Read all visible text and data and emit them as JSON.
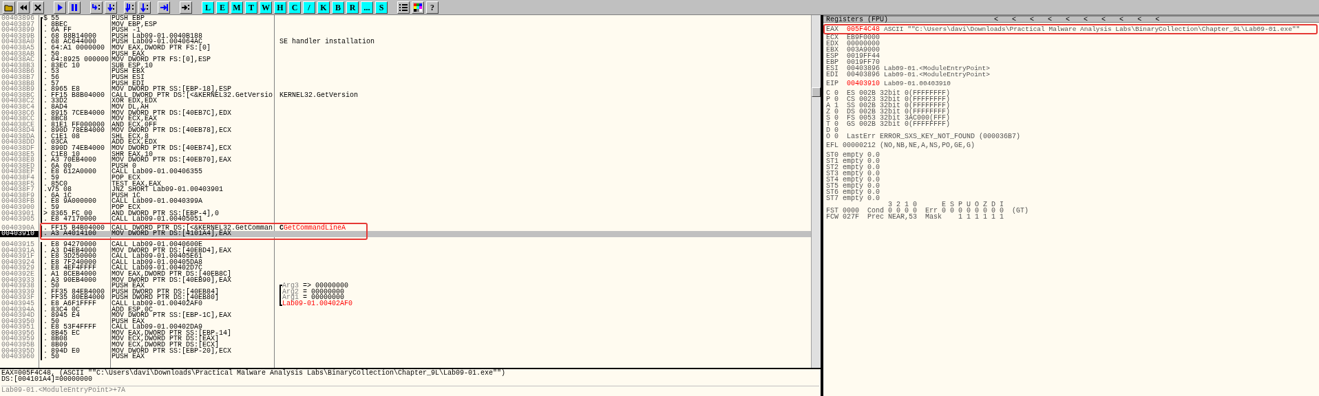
{
  "toolbar": {
    "letter_buttons": [
      "L",
      "E",
      "M",
      "T",
      "W",
      "H",
      "C",
      "/",
      "K",
      "B",
      "R",
      "...",
      "S"
    ],
    "help": "?"
  },
  "disasm": {
    "rows": [
      {
        "address": "00403896",
        "marker": "$",
        "hex": "55",
        "instruction": "PUSH EBP",
        "selected": false
      },
      {
        "address": "00403897",
        "marker": ".",
        "hex": "8BEC",
        "instruction": "MOV EBP,ESP",
        "selected": false
      },
      {
        "address": "00403899",
        "marker": ".",
        "hex": "6A FF",
        "instruction": "PUSH -1",
        "selected": false
      },
      {
        "address": "0040389B",
        "marker": ".",
        "hex": "68 88B14000",
        "instruction": "PUSH Lab09-01.0040B188",
        "selected": false
      },
      {
        "address": "004038A0",
        "marker": ".",
        "hex": "68 AC644000",
        "instruction": "PUSH Lab09-01.004064AC",
        "selected": false,
        "comment": {
          "text": "SE handler installation"
        }
      },
      {
        "address": "004038A5",
        "marker": ".",
        "hex": "64:A1 0000000",
        "instruction": "MOV EAX,DWORD PTR FS:[0]",
        "selected": false
      },
      {
        "address": "004038AB",
        "marker": ".",
        "hex": "50",
        "instruction": "PUSH EAX",
        "selected": false
      },
      {
        "address": "004038AC",
        "marker": ".",
        "hex": "64:8925 000000",
        "instruction": "MOV DWORD PTR FS:[0],ESP",
        "selected": false
      },
      {
        "address": "004038B3",
        "marker": ".",
        "hex": "83EC 10",
        "instruction": "SUB ESP,10",
        "selected": false
      },
      {
        "address": "004038B6",
        "marker": ".",
        "hex": "53",
        "instruction": "PUSH EBX",
        "selected": false
      },
      {
        "address": "004038B7",
        "marker": ".",
        "hex": "56",
        "instruction": "PUSH ESI",
        "selected": false
      },
      {
        "address": "004038B8",
        "marker": ".",
        "hex": "57",
        "instruction": "PUSH EDI",
        "selected": false
      },
      {
        "address": "004038B9",
        "marker": ".",
        "hex": "8965 E8",
        "instruction": "MOV DWORD PTR SS:[EBP-18],ESP",
        "selected": false
      },
      {
        "address": "004038BC",
        "marker": ".",
        "hex": "FF15 B8B04000",
        "instruction": "CALL DWORD PTR DS:[<&KERNEL32.GetVersio",
        "selected": false,
        "comment": {
          "text": "KERNEL32.GetVersion"
        }
      },
      {
        "address": "004038C2",
        "marker": ".",
        "hex": "33D2",
        "instruction": "XOR EDX,EDX",
        "selected": false
      },
      {
        "address": "004038C4",
        "marker": ".",
        "hex": "8AD4",
        "instruction": "MOV DL,AH",
        "selected": false
      },
      {
        "address": "004038C6",
        "marker": ".",
        "hex": "8915 7CEB4000",
        "instruction": "MOV DWORD PTR DS:[40EB7C],EDX",
        "selected": false
      },
      {
        "address": "004038CC",
        "marker": ".",
        "hex": "8BC8",
        "instruction": "MOV ECX,EAX",
        "selected": false
      },
      {
        "address": "004038CE",
        "marker": ".",
        "hex": "81E1 FF000000",
        "instruction": "AND ECX,0FF",
        "selected": false
      },
      {
        "address": "004038D4",
        "marker": ".",
        "hex": "890D 78EB4000",
        "instruction": "MOV DWORD PTR DS:[40EB78],ECX",
        "selected": false
      },
      {
        "address": "004038DA",
        "marker": ".",
        "hex": "C1E1 08",
        "instruction": "SHL ECX,8",
        "selected": false
      },
      {
        "address": "004038DD",
        "marker": ".",
        "hex": "03CA",
        "instruction": "ADD ECX,EDX",
        "selected": false
      },
      {
        "address": "004038DF",
        "marker": ".",
        "hex": "890D 74EB4000",
        "instruction": "MOV DWORD PTR DS:[40EB74],ECX",
        "selected": false
      },
      {
        "address": "004038E5",
        "marker": ".",
        "hex": "C1E8 10",
        "instruction": "SHR EAX,10",
        "selected": false
      },
      {
        "address": "004038E8",
        "marker": ".",
        "hex": "A3 70EB4000",
        "instruction": "MOV DWORD PTR DS:[40EB70],EAX",
        "selected": false
      },
      {
        "address": "004038ED",
        "marker": ".",
        "hex": "6A 00",
        "instruction": "PUSH 0",
        "selected": false
      },
      {
        "address": "004038EF",
        "marker": ".",
        "hex": "E8 612A0000",
        "instruction": "CALL Lab09-01.00406355",
        "selected": false
      },
      {
        "address": "004038F4",
        "marker": ".",
        "hex": "59",
        "instruction": "POP ECX",
        "selected": false
      },
      {
        "address": "004038F5",
        "marker": ".",
        "hex": "85C0",
        "instruction": "TEST EAX,EAX",
        "selected": false
      },
      {
        "address": "004038F7",
        "marker": ".v",
        "hex": "75 08",
        "instruction": "JNZ SHORT Lab09-01.00403901",
        "selected": false
      },
      {
        "address": "004038F9",
        "marker": ".",
        "hex": "6A 1C",
        "instruction": "PUSH 1C",
        "selected": false
      },
      {
        "address": "004038FB",
        "marker": ".",
        "hex": "E8 9A000000",
        "instruction": "CALL Lab09-01.0040399A",
        "selected": false
      },
      {
        "address": "00403900",
        "marker": ".",
        "hex": "59",
        "instruction": "POP ECX",
        "selected": false
      },
      {
        "address": "00403901",
        "marker": ">",
        "hex": "8365 FC 00",
        "instruction": "AND DWORD PTR SS:[EBP-4],0",
        "selected": false
      },
      {
        "address": "00403905",
        "marker": ".",
        "hex": "E8 47170000",
        "instruction": "CALL Lab09-01.00405051",
        "selected": false
      },
      {
        "address": "0040390A",
        "marker": ".",
        "hex": "FF15 B4B04000",
        "instruction": "CALL DWORD PTR DS:[<&KERNEL32.GetComman",
        "selected": false,
        "comment": {
          "mark": "C",
          "text": "GetCommandLineA",
          "color": "#ff0000"
        }
      },
      {
        "address": "00403910",
        "marker": ".",
        "hex": "A3 A4014100",
        "instruction": "MOV DWORD PTR DS:[4101A4],EAX",
        "selected": true
      },
      {
        "address": "00403915",
        "marker": ".",
        "hex": "E8 94270000",
        "instruction": "CALL Lab09-01.0040600E",
        "selected": false
      },
      {
        "address": "0040391A",
        "marker": ".",
        "hex": "A3 D4EB4000",
        "instruction": "MOV DWORD PTR DS:[40EBD4],EAX",
        "selected": false
      },
      {
        "address": "0040391F",
        "marker": ".",
        "hex": "E8 3D250000",
        "instruction": "CALL Lab09-01.00405E61",
        "selected": false
      },
      {
        "address": "00403924",
        "marker": ".",
        "hex": "E8 7F240000",
        "instruction": "CALL Lab09-01.00405DA8",
        "selected": false
      },
      {
        "address": "00403929",
        "marker": ".",
        "hex": "E8 4EF4FFFF",
        "instruction": "CALL Lab09-01.00402D7C",
        "selected": false
      },
      {
        "address": "0040392E",
        "marker": ".",
        "hex": "A1 8CEB4000",
        "instruction": "MOV EAX,DWORD PTR DS:[40EB8C]",
        "selected": false
      },
      {
        "address": "00403933",
        "marker": ".",
        "hex": "A3 90EB4000",
        "instruction": "MOV DWORD PTR DS:[40EB90],EAX",
        "selected": false
      },
      {
        "address": "00403938",
        "marker": ".",
        "hex": "50",
        "instruction": "PUSH EAX",
        "selected": false,
        "comment": {
          "bracket": true,
          "label": "Arg3",
          "text": "=> 00000000"
        }
      },
      {
        "address": "00403939",
        "marker": ".",
        "hex": "FF35 84EB4000",
        "instruction": "PUSH DWORD PTR DS:[40EB84]",
        "selected": false,
        "comment": {
          "bracket": true,
          "label": "Arg2",
          "text": "= 00000000"
        }
      },
      {
        "address": "0040393F",
        "marker": ".",
        "hex": "FF35 80EB4000",
        "instruction": "PUSH DWORD PTR DS:[40EB80]",
        "selected": false,
        "comment": {
          "bracket": true,
          "label": "Arg1",
          "text": "= 00000000"
        }
      },
      {
        "address": "00403945",
        "marker": ".",
        "hex": "E8 A6F1FFFF",
        "instruction": "CALL Lab09-01.00402AF0",
        "selected": false,
        "comment": {
          "bracket": true,
          "text": "Lab09-01.00402AF0",
          "color": "#ff0000"
        }
      },
      {
        "address": "0040394A",
        "marker": ".",
        "hex": "83C4 0C",
        "instruction": "ADD ESP,0C",
        "selected": false
      },
      {
        "address": "0040394D",
        "marker": ".",
        "hex": "8945 E4",
        "instruction": "MOV DWORD PTR SS:[EBP-1C],EAX",
        "selected": false
      },
      {
        "address": "00403950",
        "marker": ".",
        "hex": "50",
        "instruction": "PUSH EAX",
        "selected": false
      },
      {
        "address": "00403951",
        "marker": ".",
        "hex": "E8 53F4FFFF",
        "instruction": "CALL Lab09-01.00402DA9",
        "selected": false
      },
      {
        "address": "00403956",
        "marker": ".",
        "hex": "8B45 EC",
        "instruction": "MOV EAX,DWORD PTR SS:[EBP-14]",
        "selected": false
      },
      {
        "address": "00403959",
        "marker": ".",
        "hex": "8B08",
        "instruction": "MOV ECX,DWORD PTR DS:[EAX]",
        "selected": false
      },
      {
        "address": "0040395B",
        "marker": ".",
        "hex": "8B09",
        "instruction": "MOV ECX,DWORD PTR DS:[ECX]",
        "selected": false
      },
      {
        "address": "0040395D",
        "marker": ".",
        "hex": "894D E0",
        "instruction": "MOV DWORD PTR SS:[EBP-20],ECX",
        "selected": false
      },
      {
        "address": "00403960",
        "marker": ".",
        "hex": "50",
        "instruction": "PUSH EAX",
        "selected": false
      }
    ]
  },
  "info": {
    "lines": [
      "EAX=005F4C48, (ASCII \"\"C:\\Users\\davi\\Downloads\\Practical Malware Analysis Labs\\BinaryCollection\\Chapter_9L\\Lab09-01.exe\"\")",
      "DS:[004101A4]=00000000"
    ],
    "location": "Lab09-01.<ModuleEntryPoint>+7A"
  },
  "registers": {
    "title": "Registers (FPU)",
    "markers": [
      "<",
      "<",
      "<",
      "<",
      "<",
      "<",
      "<",
      "<",
      "<",
      "<"
    ],
    "general": [
      {
        "name": "EAX",
        "value": "005F4C48",
        "changed": true,
        "comment": "ASCII \"\"C:\\Users\\davi\\Downloads\\Practical Malware Analysis Labs\\BinaryCollection\\Chapter_9L\\Lab09-01.exe\"\""
      },
      {
        "name": "ECX",
        "value": "EB9F0000",
        "changed": false
      },
      {
        "name": "EDX",
        "value": "00000000",
        "changed": false
      },
      {
        "name": "EBX",
        "value": "003A9000",
        "changed": false
      },
      {
        "name": "ESP",
        "value": "0019FF44",
        "changed": false
      },
      {
        "name": "EBP",
        "value": "0019FF70",
        "changed": false
      },
      {
        "name": "ESI",
        "value": "00403896",
        "changed": false,
        "comment": "Lab09-01.<ModuleEntryPoint>"
      },
      {
        "name": "EDI",
        "value": "00403896",
        "changed": false,
        "comment": "Lab09-01.<ModuleEntryPoint>"
      }
    ],
    "eip": {
      "name": "EIP",
      "value": "00403910",
      "changed": true,
      "comment": "Lab09-01.00403910"
    },
    "flags": [
      "C 0  ES 002B 32bit 0(FFFFFFFF)",
      "P 0  CS 0023 32bit 0(FFFFFFFF)",
      "A 1  SS 002B 32bit 0(FFFFFFFF)",
      "Z 0  DS 002B 32bit 0(FFFFFFFF)",
      "S 0  FS 0053 32bit 3AC000(FFF)",
      "T 0  GS 002B 32bit 0(FFFFFFFF)",
      "D 0",
      "O 0  LastErr ERROR_SXS_KEY_NOT_FOUND (000036B7)"
    ],
    "efl": "EFL 00000212 (NO,NB,NE,A,NS,PO,GE,G)",
    "fpu": [
      "ST0 empty 0.0",
      "ST1 empty 0.0",
      "ST2 empty 0.0",
      "ST3 empty 0.0",
      "ST4 empty 0.0",
      "ST5 empty 0.0",
      "ST6 empty 0.0",
      "ST7 empty 0.0",
      "               3 2 1 0      E S P U O Z D I",
      "FST 0000  Cond 0 0 0 0  Err 0 0 0 0 0 0 0 0  (GT)",
      "FCW 027F  Prec NEAR,53  Mask    1 1 1 1 1 1"
    ]
  }
}
